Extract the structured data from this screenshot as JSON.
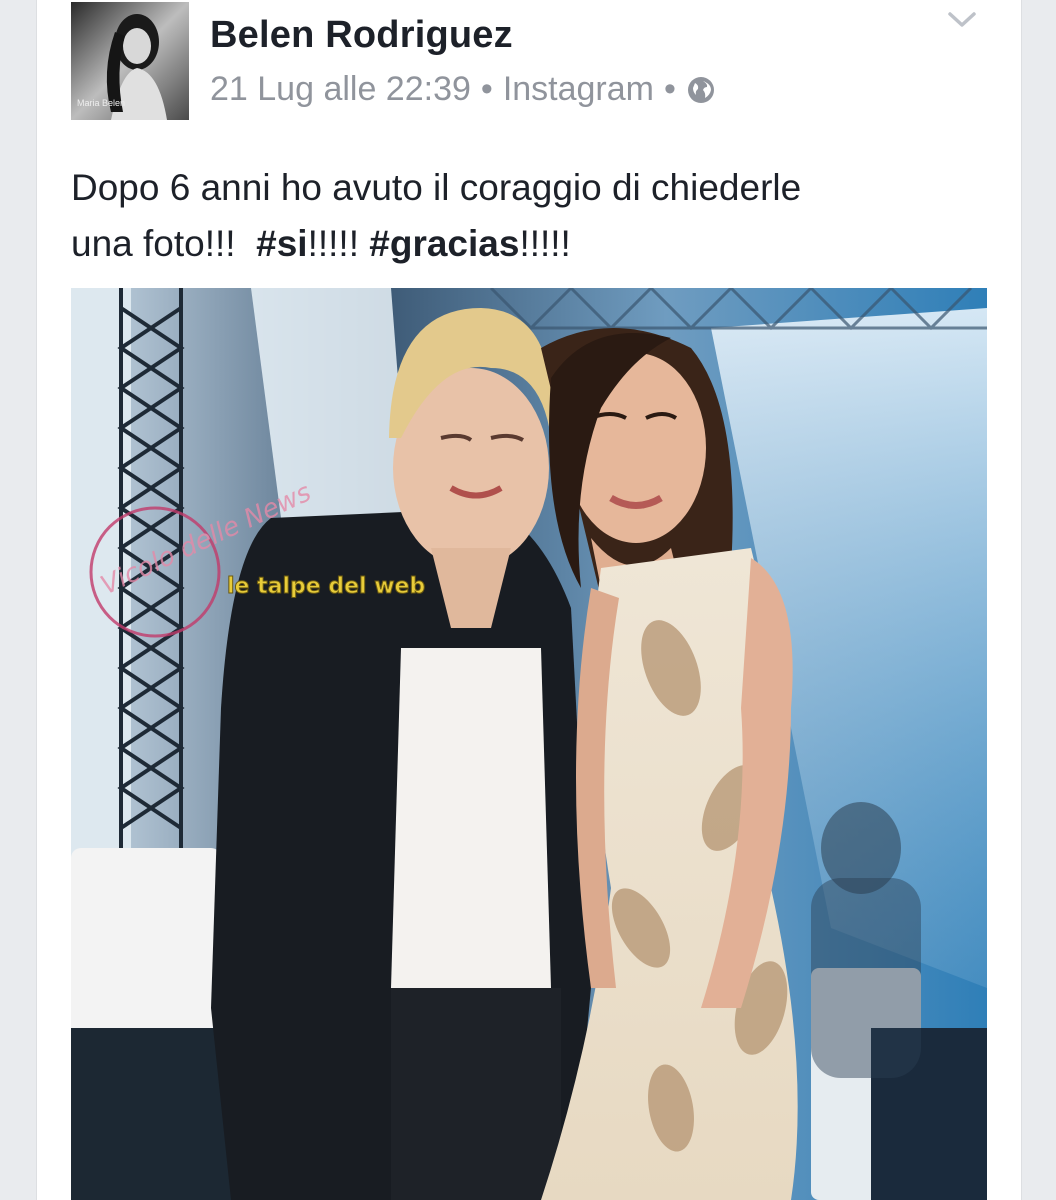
{
  "post": {
    "author": "Belen Rodriguez",
    "date": "21 Lug alle 22:39",
    "separator1": "•",
    "source": "Instagram",
    "separator2": "•",
    "privacy_icon": "globe-icon",
    "menu_icon": "chevron-down-icon",
    "text_line1": "Dopo 6 anni ho avuto il coraggio di chiederle",
    "text_line2_prefix": "una foto!!!  ",
    "hashtag1": "#si",
    "hashtag1_suffix": "!!!!! ",
    "hashtag2": "#gracias",
    "hashtag2_suffix": "!!!!!"
  },
  "avatar": {
    "caption": "Maria Belen"
  },
  "photo": {
    "watermark_left": "Vicolo delle News",
    "watermark_center": "le talpe del web"
  },
  "colors": {
    "name": "#1d2129",
    "meta": "#90949c",
    "background": "#e9ebee",
    "card": "#ffffff"
  }
}
